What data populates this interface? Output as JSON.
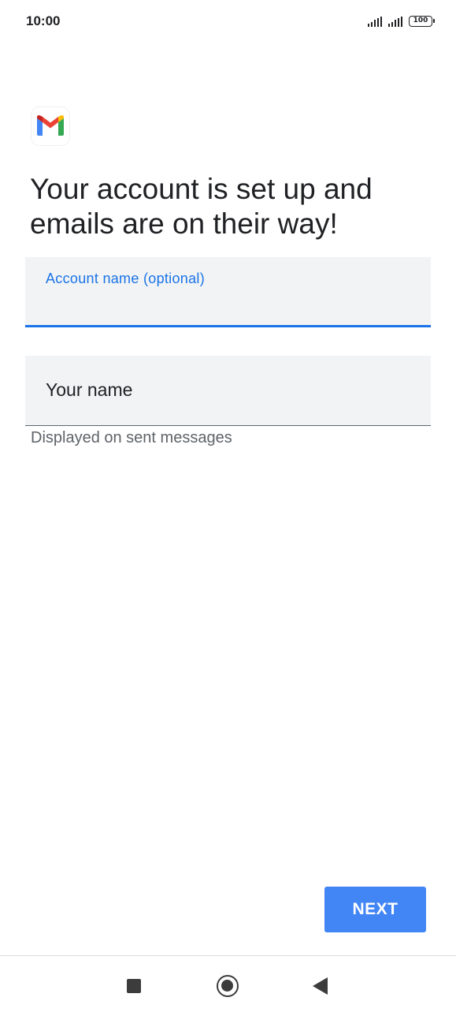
{
  "status_bar": {
    "time": "10:00",
    "battery": "100"
  },
  "logo": {
    "icon": "gmail-logo-icon"
  },
  "heading": "Your account is set up and emails are on their way!",
  "account_name_field": {
    "label": "Account name (optional)",
    "value": ""
  },
  "your_name_field": {
    "placeholder": "Your name",
    "value": "",
    "helper": "Displayed on sent messages"
  },
  "next_button": {
    "label": "NEXT"
  },
  "nav_bar": {
    "recents_icon": "square-recents-icon",
    "home_icon": "circle-home-icon",
    "back_icon": "triangle-back-icon"
  },
  "colors": {
    "accent": "#1a73e8",
    "button": "#4285f4",
    "field_bg": "#f1f3f4"
  }
}
